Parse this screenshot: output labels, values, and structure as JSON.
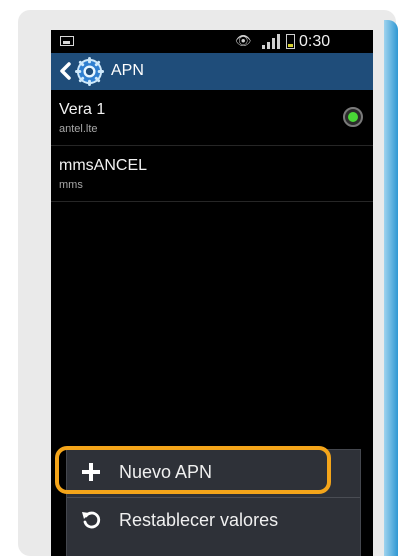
{
  "status_bar": {
    "time": "0:30"
  },
  "action_bar": {
    "title": "APN"
  },
  "apn_list": [
    {
      "name": "Vera 1",
      "apn": "antel.lte",
      "selected": true
    },
    {
      "name": "mmsANCEL",
      "apn": "mms",
      "selected": false
    }
  ],
  "menu": {
    "items": [
      {
        "label": "Nuevo APN",
        "icon": "plus-icon"
      },
      {
        "label": "Restablecer valores",
        "icon": "reset-icon"
      }
    ]
  },
  "colors": {
    "action_bar": "#1f4d7a",
    "highlight": "#f4a51a",
    "radio_selected": "#49d836",
    "accent_bar": "#2f98d3"
  }
}
